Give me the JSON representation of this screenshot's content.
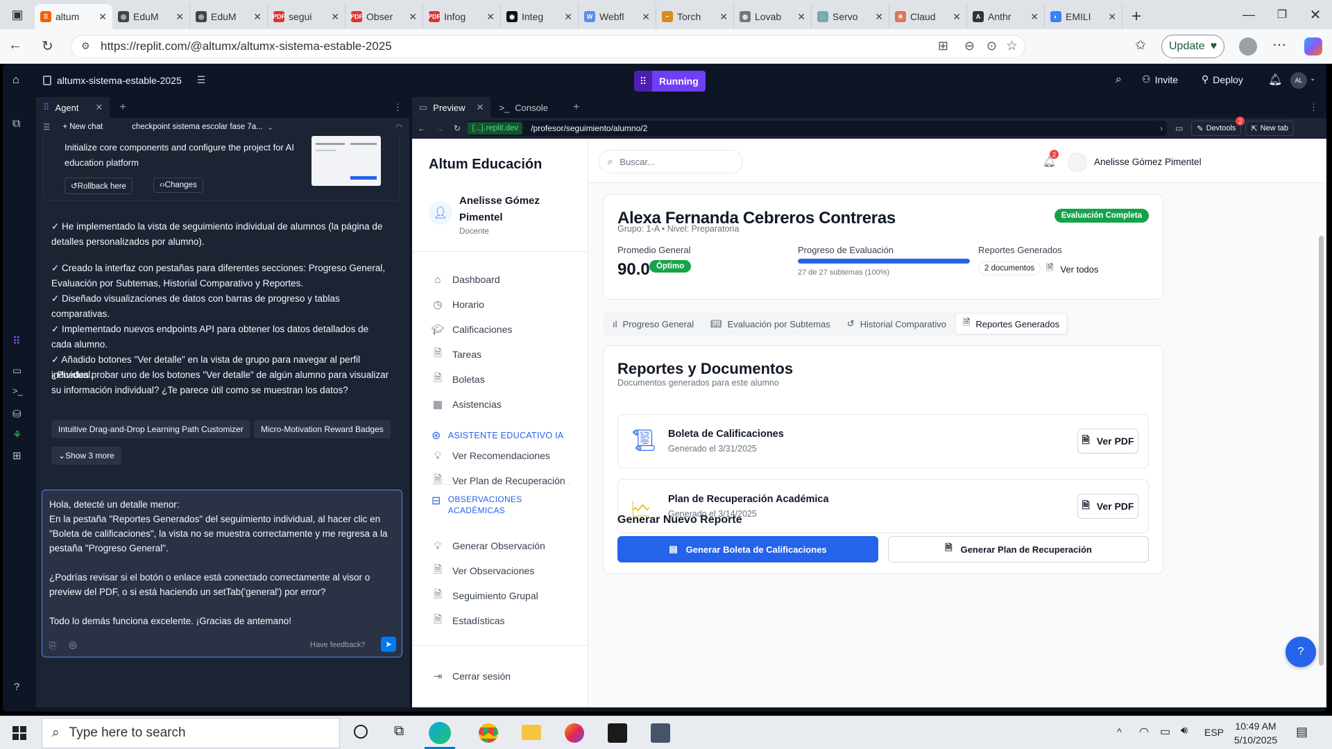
{
  "browser": {
    "tabs": [
      {
        "title": "altum",
        "color": "#f26207",
        "glyph": "⠿",
        "active": true
      },
      {
        "title": "EduM",
        "color": "#444",
        "glyph": "◎"
      },
      {
        "title": "EduM",
        "color": "#444",
        "glyph": "◎"
      },
      {
        "title": "segui",
        "color": "#d33",
        "glyph": "PDF"
      },
      {
        "title": "Obser",
        "color": "#d33",
        "glyph": "PDF"
      },
      {
        "title": "Infog",
        "color": "#d33",
        "glyph": "PDF"
      },
      {
        "title": "Integ",
        "color": "#111",
        "glyph": "◉"
      },
      {
        "title": "Webfl",
        "color": "#5b8def",
        "glyph": "W"
      },
      {
        "title": "Torch",
        "color": "#d98a1a",
        "glyph": "~"
      },
      {
        "title": "Lovab",
        "color": "#777",
        "glyph": "◍"
      },
      {
        "title": "Servo",
        "color": "#7aa",
        "glyph": "◌"
      },
      {
        "title": "Claud",
        "color": "#d97757",
        "glyph": "✳"
      },
      {
        "title": "Anthr",
        "color": "#333",
        "glyph": "A"
      },
      {
        "title": "EMILI",
        "color": "#3b82f6",
        "glyph": "◐"
      }
    ],
    "url": "https://replit.com/@altumx/altumx-sistema-estable-2025",
    "update_label": "Update"
  },
  "replit": {
    "project": "altumx-sistema-estable-2025",
    "status": "Running",
    "invite": "Invite",
    "deploy": "Deploy",
    "avatar": "AL",
    "agent_tab": "Agent",
    "new_chat": "New chat",
    "checkpoint": "checkpoint sistema escolar fase 7a...",
    "checkpoint_text": "Initialize core components and configure the project for AI education platform",
    "rollback": "Rollback here",
    "changes": "Changes",
    "messages": [
      "✓ He implementado la vista de seguimiento individual de alumnos (la página de detalles personalizados por alumno).",
      "✓ Creado la interfaz con pestañas para diferentes secciones: Progreso General, Evaluación por Subtemas, Historial Comparativo y Reportes.\n✓ Diseñado visualizaciones de datos con barras de progreso y tablas comparativas.\n✓ Implementado nuevos endpoints API para obtener los datos detallados de cada alumno.\n✓ Añadido botones \"Ver detalle\" en la vista de grupo para navegar al perfil individual.",
      "¿Puedes probar uno de los botones \"Ver detalle\" de algún alumno para visualizar su información individual? ¿Te parece útil como se muestran los datos?"
    ],
    "suggestions": [
      "Intuitive Drag-and-Drop Learning Path Customizer",
      "Micro-Motivation Reward Badges"
    ],
    "show_more": "Show 3 more",
    "input_text": "Hola, detecté un detalle menor:\nEn la pestaña \"Reportes Generados\" del seguimiento individual, al hacer clic en \"Boleta de calificaciones\", la vista no se muestra correctamente y me regresa a la pestaña \"Progreso General\".\n\n¿Podrías revisar si el botón o enlace está conectado correctamente al visor o preview del PDF, o si está haciendo un setTab('general') por error?\n\nTodo lo demás funciona excelente. ¡Gracias de antemano!",
    "feedback": "Have feedback?",
    "preview_tab": "Preview",
    "console_tab": "Console",
    "preview_host": "{...}.replit.dev",
    "preview_path": "/profesor/seguimiento/alumno/2",
    "devtools": "Devtools",
    "devtools_badge": "2",
    "new_tab": "New tab"
  },
  "app": {
    "brand": "Altum Educación",
    "user_name": "Anelisse Gómez Pimentel",
    "user_role": "Docente",
    "nav": [
      "Dashboard",
      "Horario",
      "Calificaciones",
      "Tareas",
      "Boletas",
      "Asistencias"
    ],
    "nav_icons": [
      "home-icon",
      "clock-icon",
      "graduation-cap-icon",
      "file-icon",
      "file-icon",
      "calendar-icon"
    ],
    "section_ai": "ASISTENTE EDUCATIVO IA",
    "ai_nav": [
      "Ver Recomendaciones",
      "Ver Plan de Recuperación"
    ],
    "section_obs": "OBSERVACIONES ACADÉMICAS",
    "obs_nav": [
      "Generar Observación",
      "Ver Observaciones",
      "Seguimiento Grupal",
      "Estadísticas"
    ],
    "logout": "Cerrar sesión",
    "search_placeholder": "Buscar...",
    "notif_count": "2",
    "header_user": "Anelisse Gómez Pimentel",
    "student": {
      "name": "Alexa Fernanda Cebreros Contreras",
      "meta": "Grupo: 1-A • Nivel: Preparatoria",
      "status": "Evaluación Completa",
      "avg_label": "Promedio General",
      "avg_value": "90.0",
      "avg_badge": "Óptimo",
      "prog_label": "Progreso de Evaluación",
      "prog_value": 1.0,
      "prog_text": "27 de 27 subtemas (100%)",
      "rep_label": "Reportes Generados",
      "rep_count": "2 documentos",
      "rep_link": "Ver todos"
    },
    "tabs": [
      "Progreso General",
      "Evaluación por Subtemas",
      "Historial Comparativo",
      "Reportes Generados"
    ],
    "reports_title": "Reportes y Documentos",
    "reports_sub": "Documentos generados para este alumno",
    "docs": [
      {
        "title": "Boleta de Calificaciones",
        "date": "Generado el 3/31/2025",
        "action": "Ver PDF",
        "color": "#2563eb"
      },
      {
        "title": "Plan de Recuperación Académica",
        "date": "Generado el 3/14/2025",
        "action": "Ver PDF",
        "color": "#eab308"
      }
    ],
    "gen_title": "Generar Nuevo Reporte",
    "gen_btn1": "Generar Boleta de Calificaciones",
    "gen_btn2": "Generar Plan de Recuperación"
  },
  "taskbar": {
    "search": "Type here to search",
    "lang": "ESP",
    "time": "10:49 AM",
    "date": "5/10/2025"
  }
}
